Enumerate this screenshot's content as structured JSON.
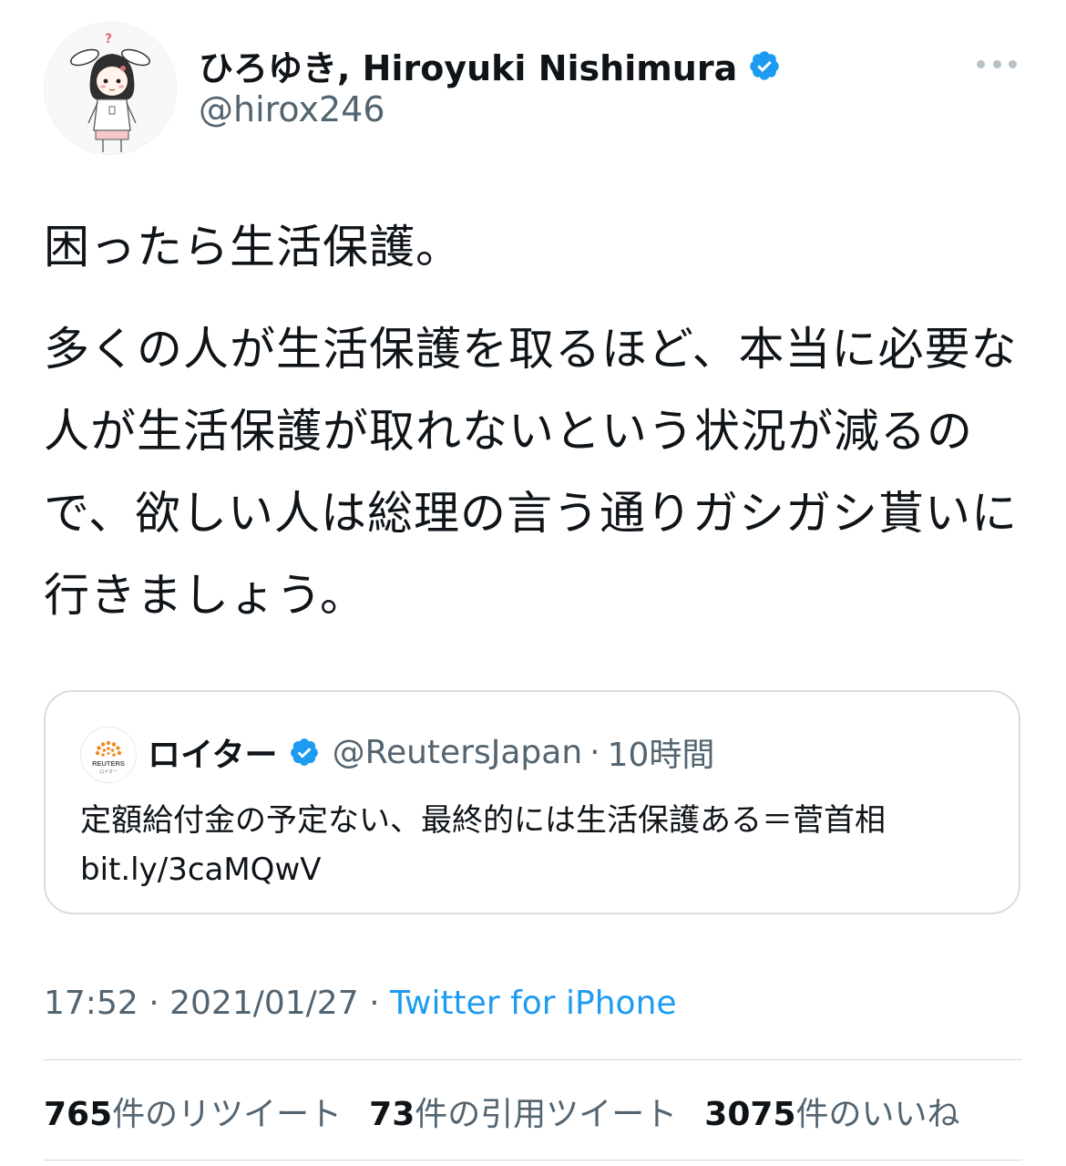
{
  "author": {
    "display_name": "ひろゆき, Hiroyuki Nishimura",
    "handle": "@hirox246",
    "verified": true
  },
  "tweet": {
    "paragraphs": [
      "困ったら生活保護。",
      "多くの人が生活保護を取るほど、本当に必要な人が生活保護が取れないという状況が減るので、欲しい人は総理の言う通りガシガシ貰いに行きましょう。"
    ]
  },
  "quoted_tweet": {
    "display_name": "ロイター",
    "avatar_text": "REUTERS",
    "avatar_subtext": "ロイター",
    "handle": "@ReutersJapan",
    "separator": "·",
    "time": "10時間",
    "verified": true,
    "text": "定額給付金の予定ない、最終的には生活保護ある＝菅首相 bit.ly/3caMQwV"
  },
  "meta": {
    "time": "17:52",
    "separator": "·",
    "date": "2021/01/27",
    "separator2": "·",
    "source": "Twitter for iPhone"
  },
  "stats": {
    "retweets_count": "765",
    "retweets_label": "件のリツイート",
    "quotes_count": "73",
    "quotes_label": "件の引用ツイート",
    "likes_count": "3075",
    "likes_label": "件のいいね"
  },
  "colors": {
    "verified_blue": "#1d9bf0",
    "secondary_text": "#536471",
    "link": "#1d9bf0"
  },
  "icons": {
    "verified": "verified-badge-icon",
    "more": "more-horizontal-icon"
  }
}
